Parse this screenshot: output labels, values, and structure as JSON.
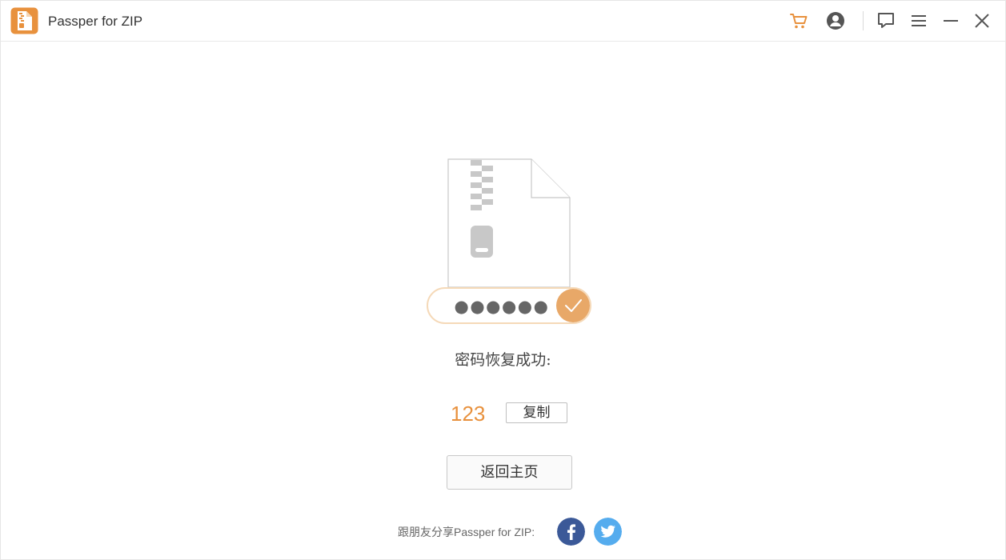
{
  "app": {
    "title": "Passper for ZIP",
    "accent_color": "#e8913d",
    "illustration_password_dots": "●●●●●●"
  },
  "titlebar_icons": [
    "cart-icon",
    "account-icon",
    "feedback-icon",
    "menu-icon",
    "minimize-icon",
    "close-icon"
  ],
  "main": {
    "status_text": "密码恢复成功:",
    "password_value": "123",
    "copy_label": "复制",
    "home_label": "返回主页"
  },
  "share": {
    "text": "跟朋友分享Passper for ZIP:",
    "facebook_color": "#3b5998",
    "twitter_color": "#55acee"
  }
}
